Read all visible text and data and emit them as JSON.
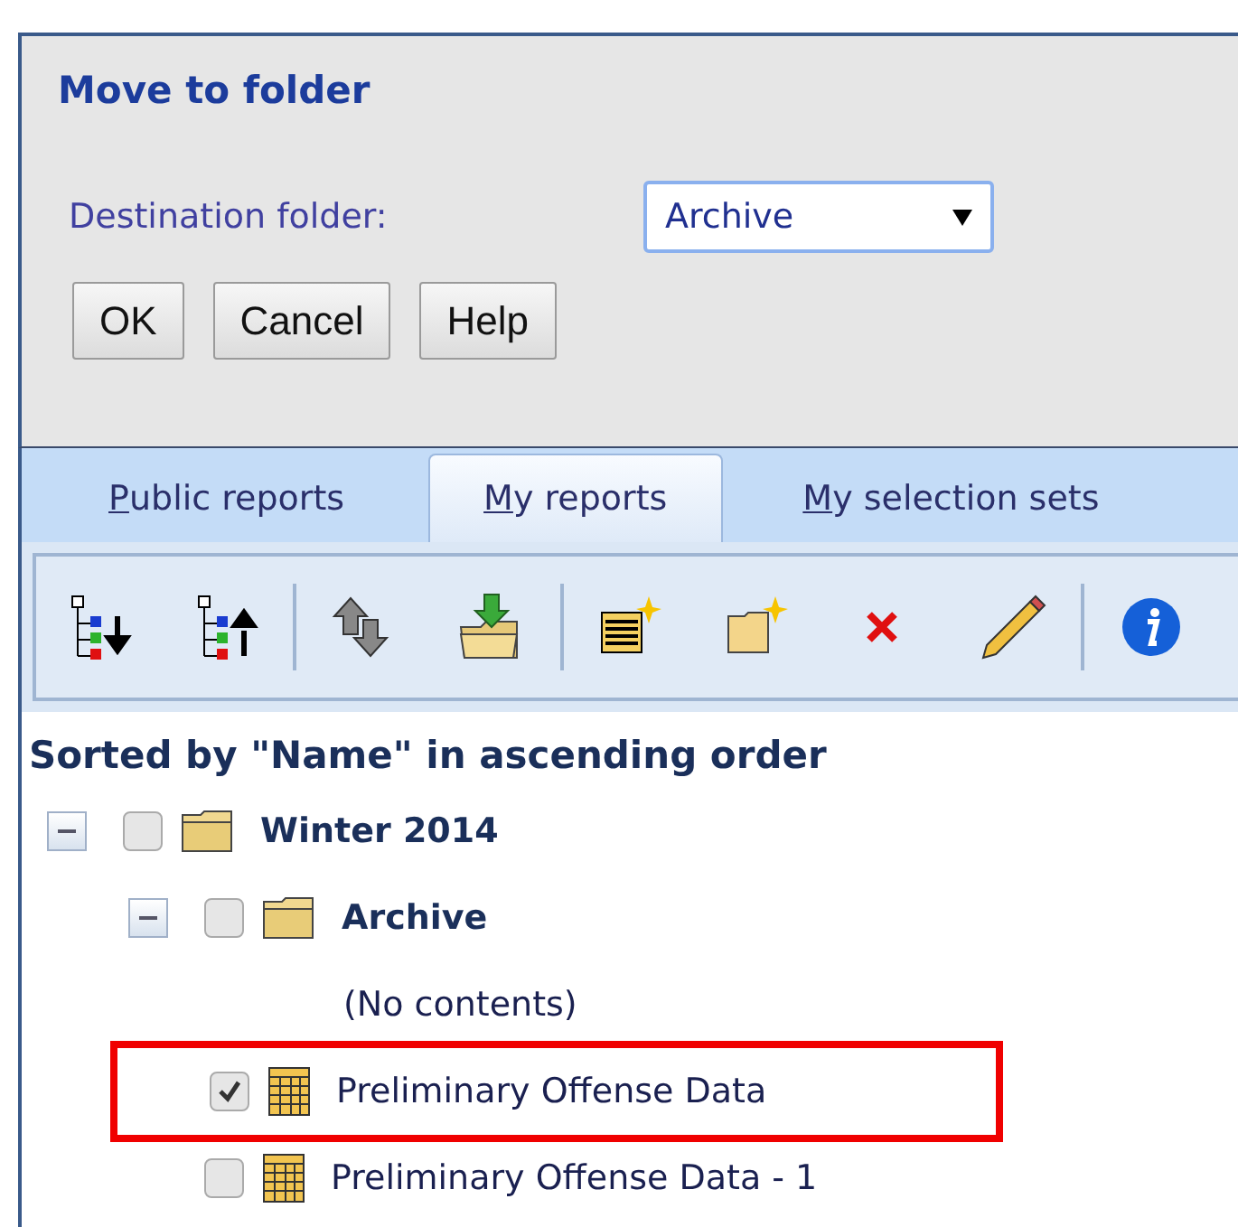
{
  "dialog": {
    "title": "Move to folder",
    "destination_label": "Destination folder:",
    "destination_value": "Archive",
    "buttons": [
      "OK",
      "Cancel",
      "Help"
    ]
  },
  "tabs": [
    {
      "mnemonic": "P",
      "rest": "ublic reports",
      "selected": false
    },
    {
      "mnemonic": "M",
      "rest": "y reports",
      "selected": true
    },
    {
      "mnemonic": "M",
      "rest": "y selection sets",
      "selected": false
    }
  ],
  "sort_caption": "Sorted by \"Name\" in ascending order",
  "tree": [
    {
      "kind": "folder",
      "label": "Winter 2014",
      "expanded": true,
      "checked": false,
      "children": [
        {
          "kind": "folder",
          "label": "Archive",
          "expanded": true,
          "checked": false,
          "children": [
            {
              "kind": "empty",
              "label": "(No contents)"
            }
          ]
        },
        {
          "kind": "report",
          "label": "Preliminary Offense Data",
          "checked": true,
          "highlighted": true
        },
        {
          "kind": "report",
          "label": "Preliminary Offense Data - 1",
          "checked": false,
          "highlighted": false
        }
      ]
    }
  ]
}
